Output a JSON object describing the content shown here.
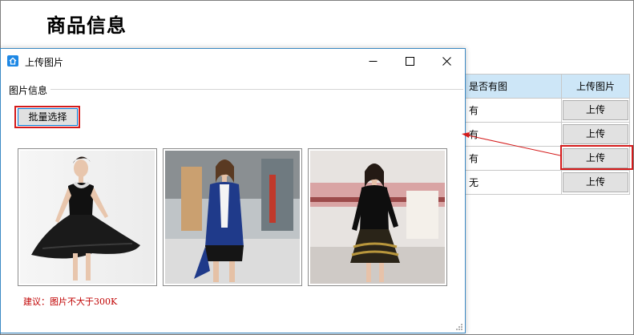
{
  "page": {
    "title": "商品信息"
  },
  "table": {
    "headers": [
      "是否有图",
      "上传图片"
    ],
    "rows": [
      {
        "has_image": "有",
        "action": "上传"
      },
      {
        "has_image": "有",
        "action": "上传"
      },
      {
        "has_image": "有",
        "action": "上传"
      },
      {
        "has_image": "无",
        "action": "上传"
      }
    ]
  },
  "dialog": {
    "title": "上传图片",
    "group_label": "图片信息",
    "batch_button": "批量选择",
    "hint": "建议：图片不大于300K",
    "photos": [
      "photo-black-dress",
      "photo-blue-jacket",
      "photo-black-gold-dress"
    ]
  },
  "colors": {
    "highlight": "#d41b1b",
    "header_bg": "#cde6f7",
    "hint_text": "#c00000",
    "dialog_border": "#3c8ac4"
  }
}
